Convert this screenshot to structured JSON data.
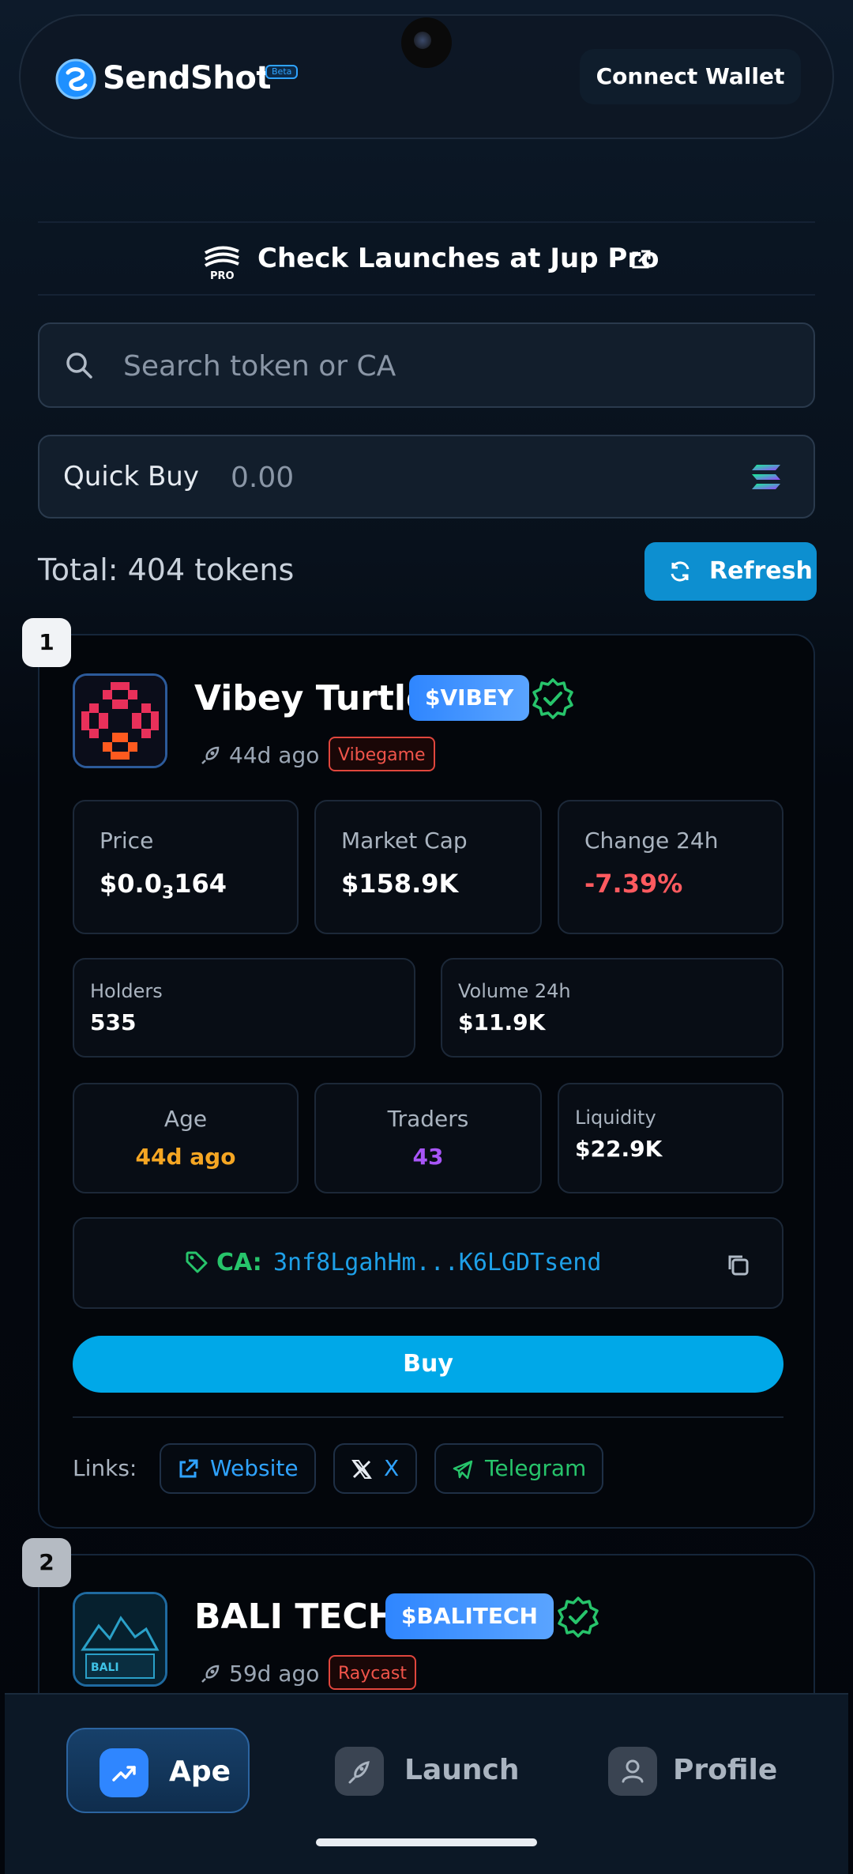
{
  "header": {
    "app_name": "SendShot",
    "beta_badge": "Beta",
    "connect_wallet": "Connect Wallet"
  },
  "jup_banner": {
    "text": "Check Launches at Jup Pro"
  },
  "search": {
    "placeholder": "Search token or CA"
  },
  "quick_buy": {
    "label": "Quick Buy",
    "placeholder": "0.00"
  },
  "list": {
    "total_text": "Total: 404 tokens",
    "refresh_label": "Refresh"
  },
  "tokens": [
    {
      "rank": "1",
      "name": "Vibey Turtle",
      "ticker": "$VIBEY",
      "age": "44d ago",
      "source": "Vibegame",
      "stats": {
        "price_label": "Price",
        "price_prefix": "$0.0",
        "price_zeros": "3",
        "price_digits": "164",
        "mcap_label": "Market Cap",
        "mcap_value": "$158.9K",
        "change_label": "Change 24h",
        "change_value": "-7.39%",
        "holders_label": "Holders",
        "holders_value": "535",
        "volume_label": "Volume 24h",
        "volume_value": "$11.9K",
        "age_label": "Age",
        "age_value": "44d ago",
        "traders_label": "Traders",
        "traders_value": "43",
        "liquidity_label": "Liquidity",
        "liquidity_value": "$22.9K"
      },
      "ca_label": "CA:",
      "ca_value": "3nf8LgahHm...K6LGDTsend",
      "buy_label": "Buy",
      "links_label": "Links:",
      "links": [
        "Website",
        "X",
        "Telegram"
      ]
    },
    {
      "rank": "2",
      "name": "BALI TECH",
      "ticker": "$BALITECH",
      "age": "59d ago",
      "source": "Raycast"
    }
  ],
  "nav": {
    "items": [
      {
        "label": "Ape",
        "icon": "trending-up-icon"
      },
      {
        "label": "Launch",
        "icon": "rocket-icon"
      },
      {
        "label": "Profile",
        "icon": "user-icon"
      }
    ]
  },
  "colors": {
    "accent": "#00a8e8",
    "positive": "#27c46b",
    "negative": "#ff5a5f",
    "age": "#f5a623",
    "traders": "#a855f7"
  }
}
